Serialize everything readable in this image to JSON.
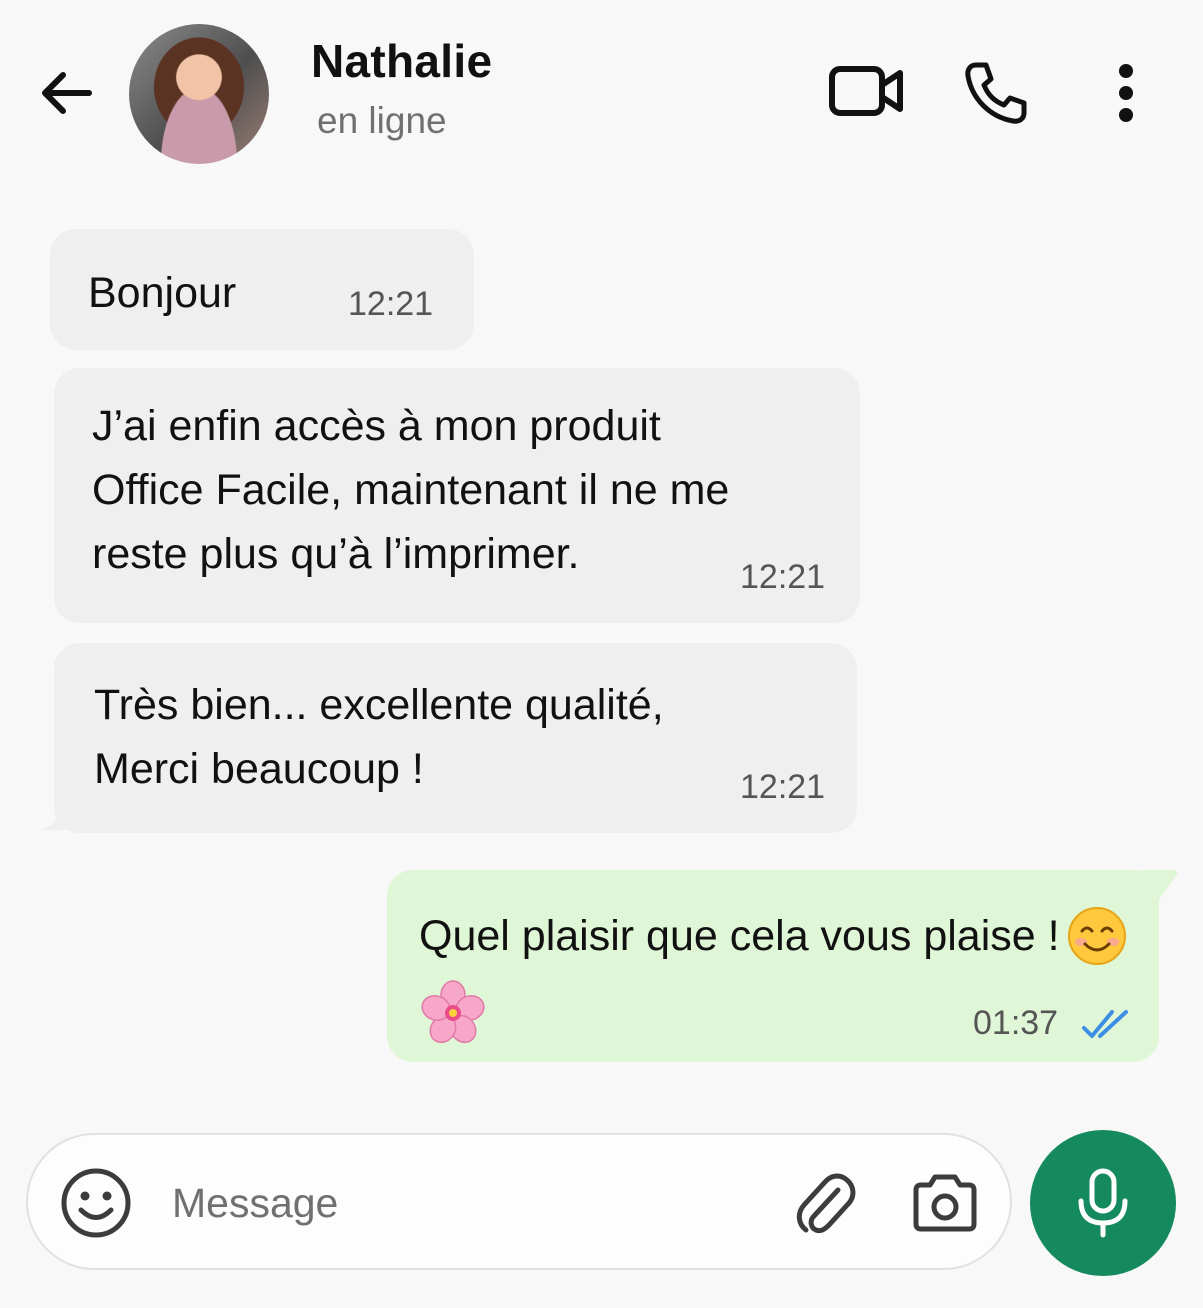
{
  "header": {
    "contact_name": "Nathalie",
    "status": "en ligne",
    "icons": [
      "arrow-left-icon",
      "video-camera-icon",
      "phone-icon",
      "more-vertical-icon"
    ]
  },
  "messages": [
    {
      "direction": "incoming",
      "text": "Bonjour",
      "time": "12:21"
    },
    {
      "direction": "incoming",
      "text": "J’ai enfin accès à mon produit\nOffice Facile, maintenant il ne me\nreste plus qu’à l’imprimer.",
      "time": "12:21"
    },
    {
      "direction": "incoming",
      "text": "Très bien... excellente qualité,\nMerci beaucoup !",
      "time": "12:21"
    },
    {
      "direction": "outgoing",
      "text": "Quel plaisir que cela vous plaise !",
      "emojis": [
        "smiling-face-icon",
        "cherry-blossom-icon"
      ],
      "time": "01:37",
      "status": "read"
    }
  ],
  "composer": {
    "placeholder": "Message",
    "value": "",
    "icons": [
      "smiley-icon",
      "paperclip-icon",
      "camera-icon",
      "microphone-icon"
    ]
  },
  "colors": {
    "background": "#f8f8f8",
    "incoming_bubble": "#efefef",
    "outgoing_bubble": "#dff7d6",
    "accent": "#168a5f",
    "read_ticks": "#3d8fe6"
  }
}
